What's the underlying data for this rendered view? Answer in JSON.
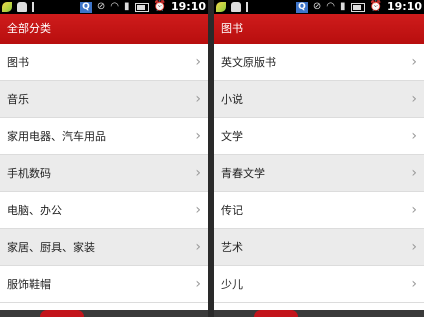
{
  "status_bar": {
    "time": "19:10",
    "icons": [
      "leaf-icon",
      "android-icon",
      "usb-icon",
      "q-icon",
      "mute-icon",
      "wifi-icon",
      "signal-icon",
      "battery-icon",
      "alarm-icon"
    ]
  },
  "left": {
    "header": "全部分类",
    "items": [
      {
        "label": "图书"
      },
      {
        "label": "音乐"
      },
      {
        "label": "家用电器、汽车用品"
      },
      {
        "label": "手机数码"
      },
      {
        "label": "电脑、办公"
      },
      {
        "label": "家居、厨具、家装"
      },
      {
        "label": "服饰鞋帽"
      }
    ]
  },
  "right": {
    "header": "图书",
    "items": [
      {
        "label": "英文原版书"
      },
      {
        "label": "小说"
      },
      {
        "label": "文学"
      },
      {
        "label": "青春文学"
      },
      {
        "label": "传记"
      },
      {
        "label": "艺术"
      },
      {
        "label": "少儿"
      }
    ]
  },
  "chevron": "›",
  "colors": {
    "header": "#c3141b",
    "row_alt": "#ebebeb"
  }
}
